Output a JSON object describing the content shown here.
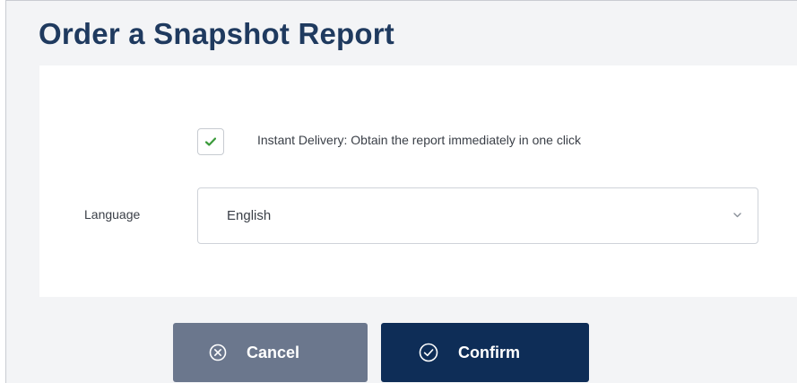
{
  "dialog": {
    "title": "Order a Snapshot Report"
  },
  "instant_delivery": {
    "checked": true,
    "label": "Instant Delivery: Obtain the report immediately in one click"
  },
  "language": {
    "label": "Language",
    "selected": "English"
  },
  "buttons": {
    "cancel_label": "Cancel",
    "confirm_label": "Confirm"
  },
  "icons": {
    "checkbox": "checkmark-icon",
    "select": "chevron-down-icon",
    "cancel": "circle-x-icon",
    "confirm": "circle-check-icon"
  },
  "colors": {
    "title": "#1f3a5f",
    "checkmark": "#3a9a3a",
    "cancel_button": "#6b778d",
    "confirm_button": "#0e2d57"
  }
}
